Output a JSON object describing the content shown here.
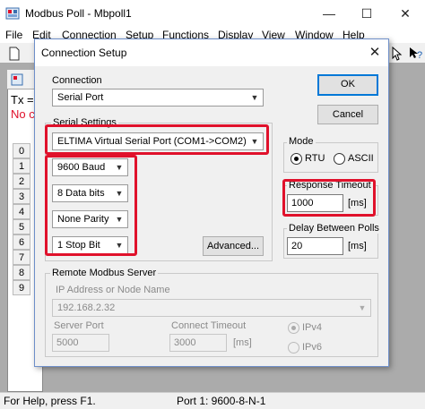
{
  "app": {
    "title": "Modbus Poll - Mbpoll1",
    "menu": [
      "File",
      "Edit",
      "Connection",
      "Setup",
      "Functions",
      "Display",
      "View",
      "Window",
      "Help"
    ],
    "child_lines": [
      "Tx =",
      "No c"
    ],
    "row_numbers": [
      "0",
      "1",
      "2",
      "3",
      "4",
      "5",
      "6",
      "7",
      "8",
      "9"
    ],
    "status_left": "For Help, press F1.",
    "status_right": "Port 1: 9600-8-N-1",
    "colors": {
      "highlight": "#e0112b",
      "default_button": "#0078d7",
      "error_text": "#e0112b"
    }
  },
  "dialog": {
    "title": "Connection Setup",
    "ok_label": "OK",
    "cancel_label": "Cancel",
    "connection": {
      "label": "Connection",
      "value": "Serial Port"
    },
    "serial": {
      "label": "Serial Settings",
      "port": "ELTIMA Virtual Serial Port (COM1->COM2)",
      "baud": "9600 Baud",
      "data_bits": "8 Data bits",
      "parity": "None Parity",
      "stop_bits": "1 Stop Bit",
      "advanced_label": "Advanced..."
    },
    "mode": {
      "label": "Mode",
      "rtu": "RTU",
      "ascii": "ASCII",
      "selected": "RTU"
    },
    "response_timeout": {
      "label": "Response Timeout",
      "value": "1000",
      "unit": "[ms]"
    },
    "delay_between_polls": {
      "label": "Delay Between Polls",
      "value": "20",
      "unit": "[ms]"
    },
    "remote": {
      "label": "Remote Modbus Server",
      "ip_label": "IP Address or Node Name",
      "ip_value": "192.168.2.32",
      "port_label": "Server Port",
      "port_value": "5000",
      "timeout_label": "Connect Timeout",
      "timeout_value": "3000",
      "timeout_unit": "[ms]",
      "ipv4": "IPv4",
      "ipv6": "IPv6",
      "selected": "IPv4"
    }
  }
}
